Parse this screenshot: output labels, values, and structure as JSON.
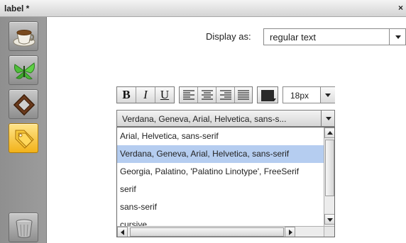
{
  "window": {
    "title": "label *",
    "close_glyph": "×"
  },
  "sidebar": {
    "tiles": [
      {
        "icon": "coffee-cup-icon"
      },
      {
        "icon": "butterfly-icon"
      },
      {
        "icon": "picture-frame-icon"
      },
      {
        "icon": "price-tags-icon"
      }
    ],
    "trash_icon": "trash-bin-icon"
  },
  "display": {
    "label": "Display as:",
    "selected": "regular text"
  },
  "toolbar": {
    "bold": "B",
    "italic": "I",
    "underline": "U",
    "align_buttons": [
      "align-left-icon",
      "align-center-icon",
      "align-right-icon",
      "align-justify-icon"
    ],
    "text_color": "#2a2a2a",
    "font_size": "18px"
  },
  "font_family": {
    "selected_display": "Verdana, Geneva, Arial, Helvetica, sans-s...",
    "options": [
      "Arial, Helvetica, sans-serif",
      "Verdana, Geneva, Arial, Helvetica, sans-serif",
      "Georgia, Palatino, 'Palatino Linotype', FreeSerif",
      "serif",
      "sans-serif",
      "cursive"
    ],
    "selected_index": 1
  },
  "colors": {
    "selection": "#b5cdf0",
    "sidebar": "#969696"
  }
}
